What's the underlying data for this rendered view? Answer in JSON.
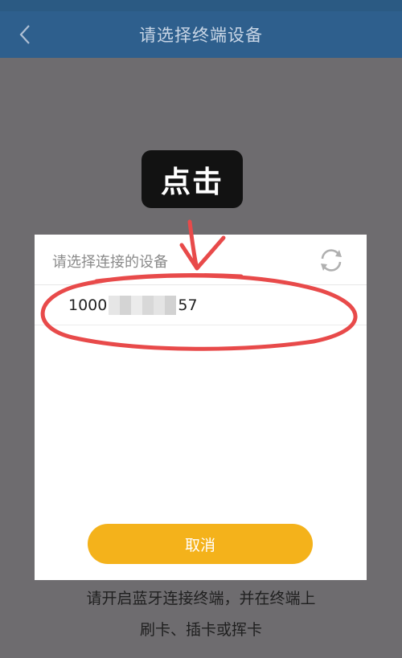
{
  "nav": {
    "title": "请选择终端设备",
    "back_icon": "chevron-left-icon"
  },
  "tooltip": {
    "text": "点击"
  },
  "dialog": {
    "title": "请选择连接的设备",
    "refresh_icon": "refresh-icon",
    "devices": [
      {
        "id_prefix": "1000",
        "id_suffix": "57"
      }
    ],
    "cancel_label": "取消"
  },
  "hint": {
    "line1": "请开启蓝牙连接终端，并在终端上",
    "line2": "刷卡、插卡或挥卡"
  },
  "colors": {
    "navbar": "#2e5f8d",
    "accent_button": "#f4b21b",
    "annotation_red": "#e84a4a",
    "overlay": "#6e6c6f"
  }
}
